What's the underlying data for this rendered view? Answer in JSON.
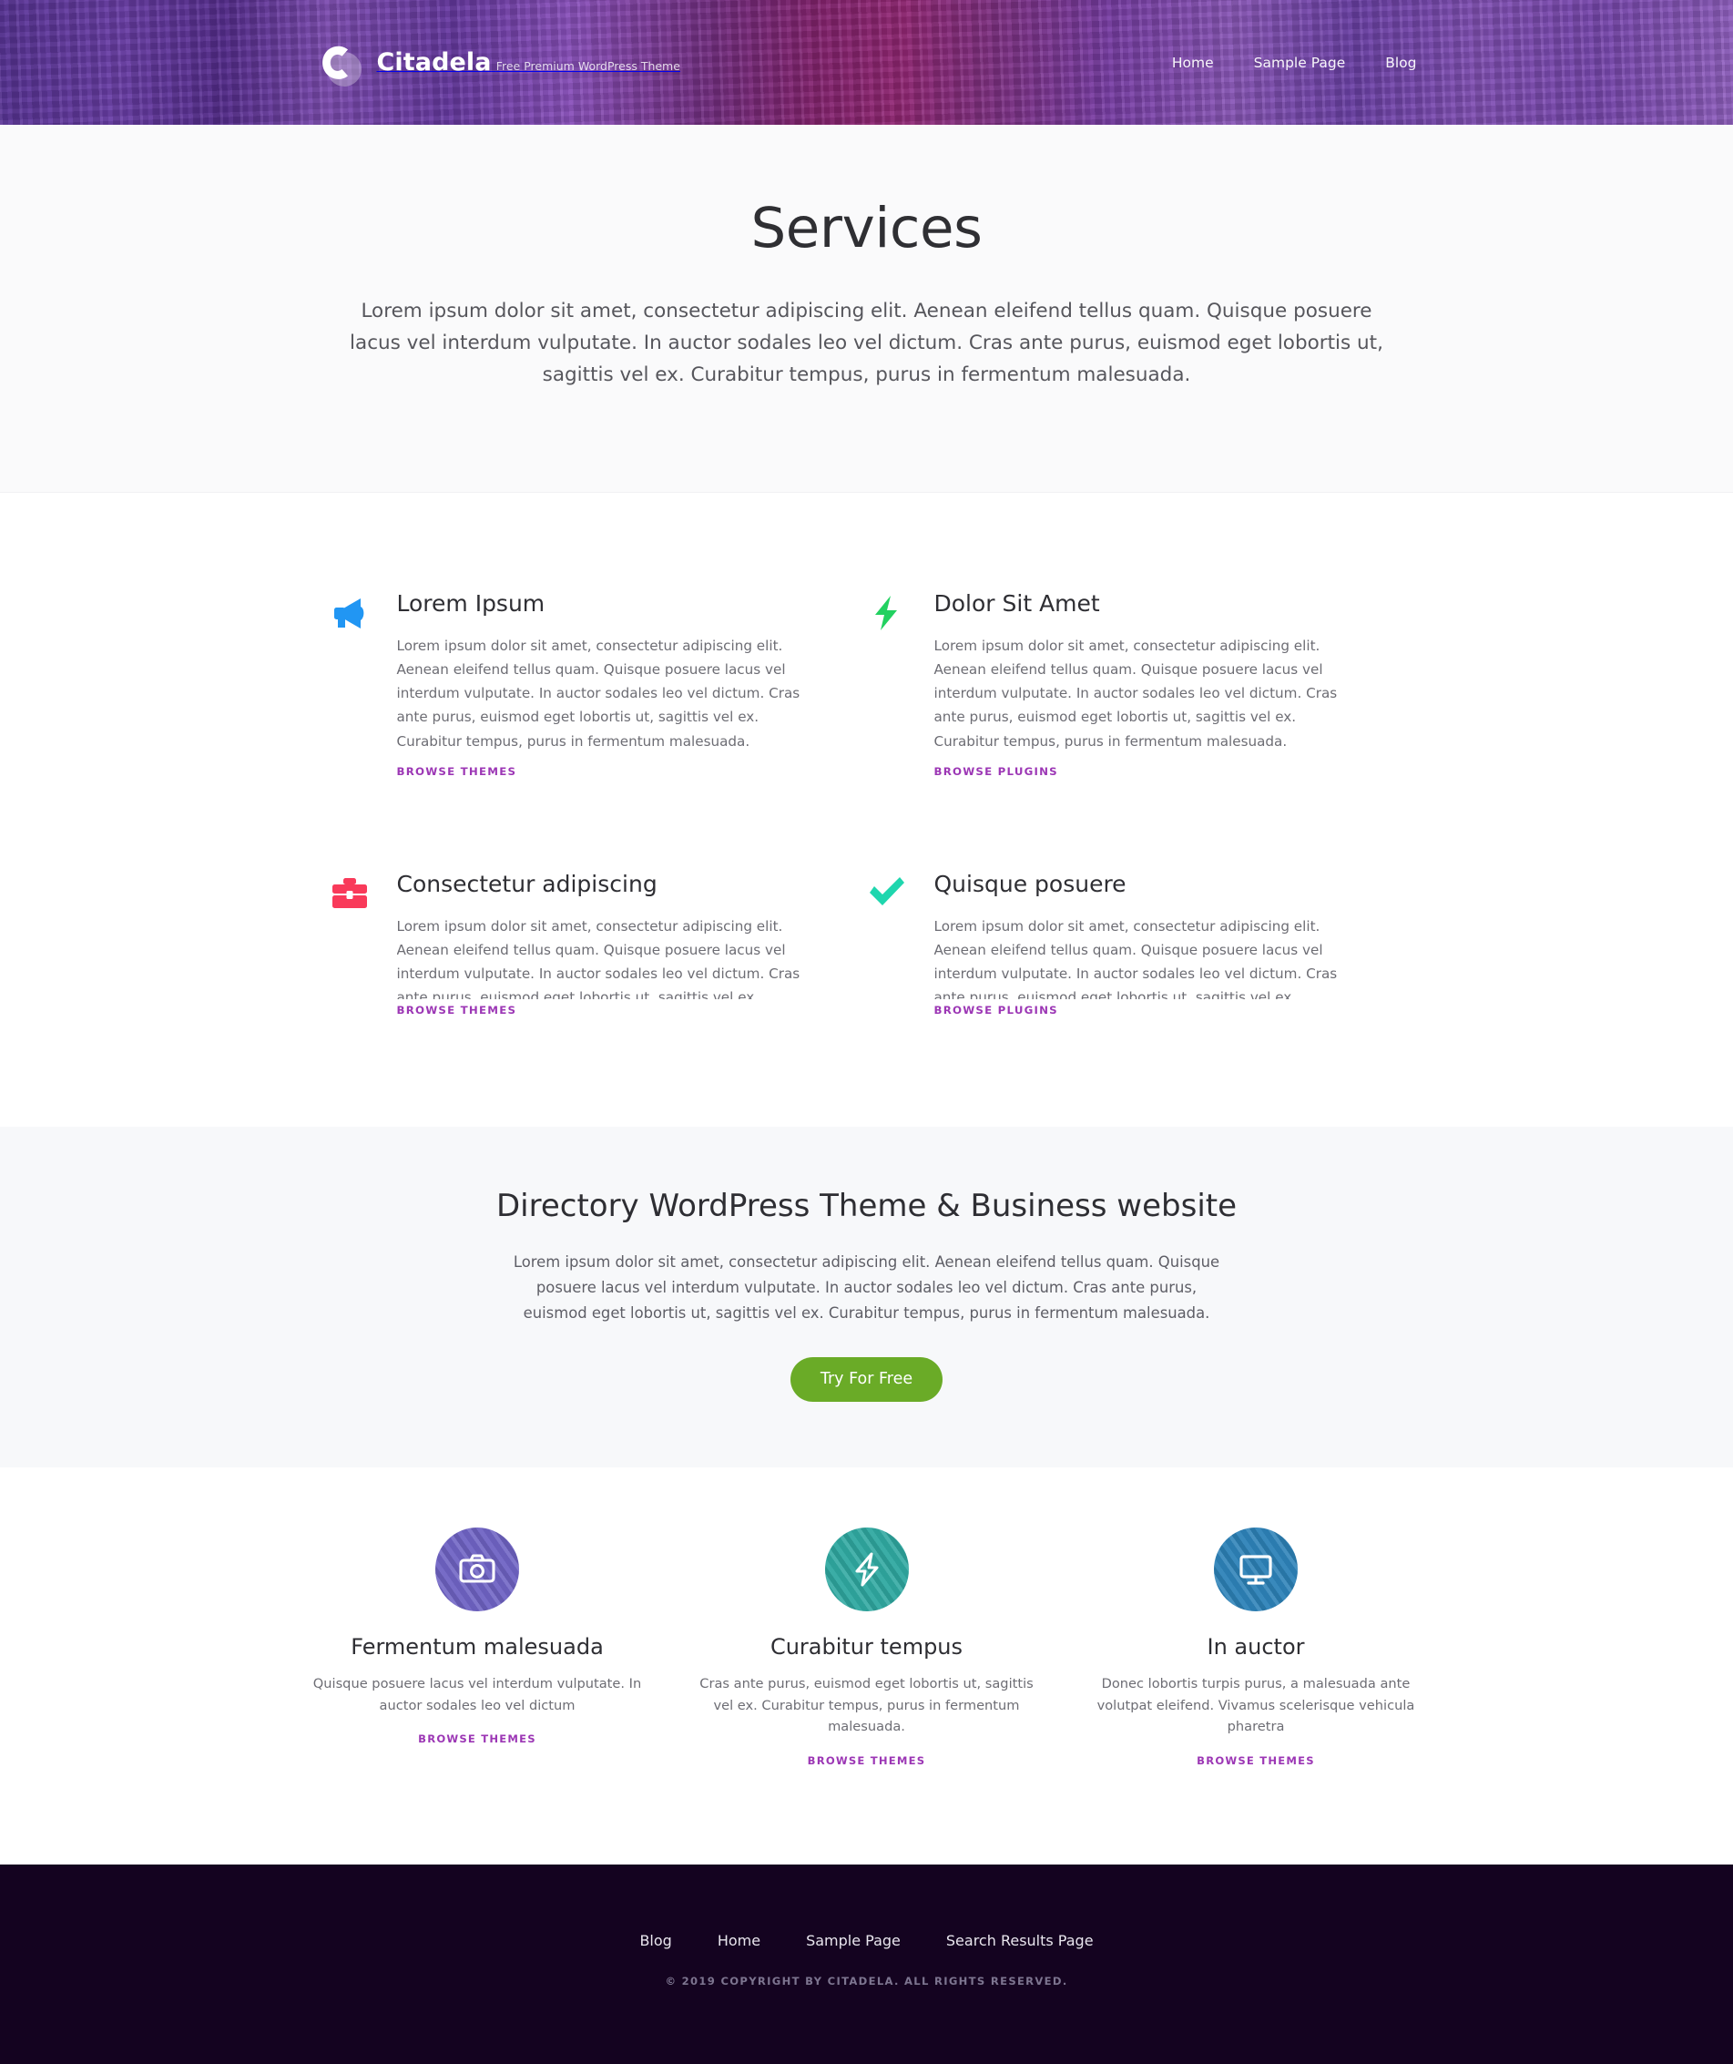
{
  "header": {
    "brand": {
      "title": "Citadela",
      "tagline": "Free Premium WordPress Theme",
      "logo_icon": "citadela-c-logo-icon"
    },
    "nav": [
      {
        "label": "Home"
      },
      {
        "label": "Sample Page"
      },
      {
        "label": "Blog"
      }
    ],
    "colors": {
      "background_tint": "#8a54b8"
    }
  },
  "hero": {
    "title": "Services",
    "description": "Lorem ipsum dolor sit amet, consectetur adipiscing elit. Aenean eleifend tellus quam. Quisque posuere lacus vel interdum vulputate. In auctor sodales leo vel dictum. Cras ante purus, euismod eget lobortis ut, sagittis vel ex. Curabitur tempus, purus in fermentum malesuada.",
    "background": "#fafafb"
  },
  "services": {
    "items": [
      {
        "icon": "megaphone-icon",
        "icon_color": "#2196f3",
        "title": "Lorem Ipsum",
        "text": "Lorem ipsum dolor sit amet, consectetur adipiscing elit. Aenean eleifend tellus quam. Quisque posuere lacus vel interdum vulputate. In auctor sodales leo vel dictum. Cras ante purus, euismod eget lobortis ut, sagittis vel ex. Curabitur tempus, purus in fermentum malesuada.",
        "link_label": "BROWSE THEMES"
      },
      {
        "icon": "lightning-bolt-icon",
        "icon_color": "#22d160",
        "title": "Dolor Sit Amet",
        "text": "Lorem ipsum dolor sit amet, consectetur adipiscing elit. Aenean eleifend tellus quam. Quisque posuere lacus vel interdum vulputate. In auctor sodales leo vel dictum. Cras ante purus, euismod eget lobortis ut, sagittis vel ex. Curabitur tempus, purus in fermentum malesuada.",
        "link_label": "BROWSE PLUGINS"
      },
      {
        "icon": "briefcase-icon",
        "icon_color": "#f93a5a",
        "title": "Consectetur adipiscing",
        "text": "Lorem ipsum dolor sit amet, consectetur adipiscing elit. Aenean eleifend tellus quam. Quisque posuere lacus vel interdum vulputate. In auctor sodales leo vel dictum. Cras ante purus, euismod eget lobortis ut, sagittis vel ex. Curabitur tempus, purus in fermentum malesuada.",
        "link_label": "BROWSE THEMES"
      },
      {
        "icon": "checkmark-icon",
        "icon_color": "#1fd6ae",
        "title": "Quisque posuere",
        "text": "Lorem ipsum dolor sit amet, consectetur adipiscing elit. Aenean eleifend tellus quam. Quisque posuere lacus vel interdum vulputate. In auctor sodales leo vel dictum. Cras ante purus, euismod eget lobortis ut, sagittis vel ex. Curabitur tempus, purus in fermentum malesuada.",
        "link_label": "BROWSE PLUGINS"
      }
    ],
    "link_color": "#9c37b5"
  },
  "cta": {
    "title": "Directory WordPress Theme & Business website",
    "text": "Lorem ipsum dolor sit amet, consectetur adipiscing elit. Aenean eleifend tellus quam. Quisque posuere lacus vel interdum vulputate. In auctor sodales leo vel dictum. Cras ante purus, euismod eget lobortis ut, sagittis vel ex. Curabitur tempus, purus in fermentum malesuada.",
    "button_label": "Try For Free",
    "button_color": "#6aab27",
    "background": "#f7f8fa"
  },
  "features": {
    "items": [
      {
        "icon": "camera-icon",
        "circle_color": "#6f63c4",
        "title": "Fermentum malesuada",
        "text": "Quisque posuere lacus vel interdum vulputate. In auctor sodales leo vel dictum",
        "link_label": "BROWSE THEMES"
      },
      {
        "icon": "lightning-bolt-outline-icon",
        "circle_color": "#2fa8a0",
        "title": "Curabitur tempus",
        "text": "Cras ante purus, euismod eget lobortis ut, sagittis vel ex. Curabitur tempus, purus in fermentum malesuada.",
        "link_label": "BROWSE THEMES"
      },
      {
        "icon": "monitor-icon",
        "circle_color": "#2d82b8",
        "title": "In auctor",
        "text": "Donec lobortis turpis purus, a malesuada ante volutpat eleifend. Vivamus scelerisque vehicula pharetra",
        "link_label": "BROWSE THEMES"
      }
    ]
  },
  "footer": {
    "nav": [
      {
        "label": "Blog"
      },
      {
        "label": "Home"
      },
      {
        "label": "Sample Page"
      },
      {
        "label": "Search Results Page"
      }
    ],
    "copyright": "© 2019 COPYRIGHT BY CITADELA. ALL RIGHTS RESERVED.",
    "background": "#140320"
  }
}
